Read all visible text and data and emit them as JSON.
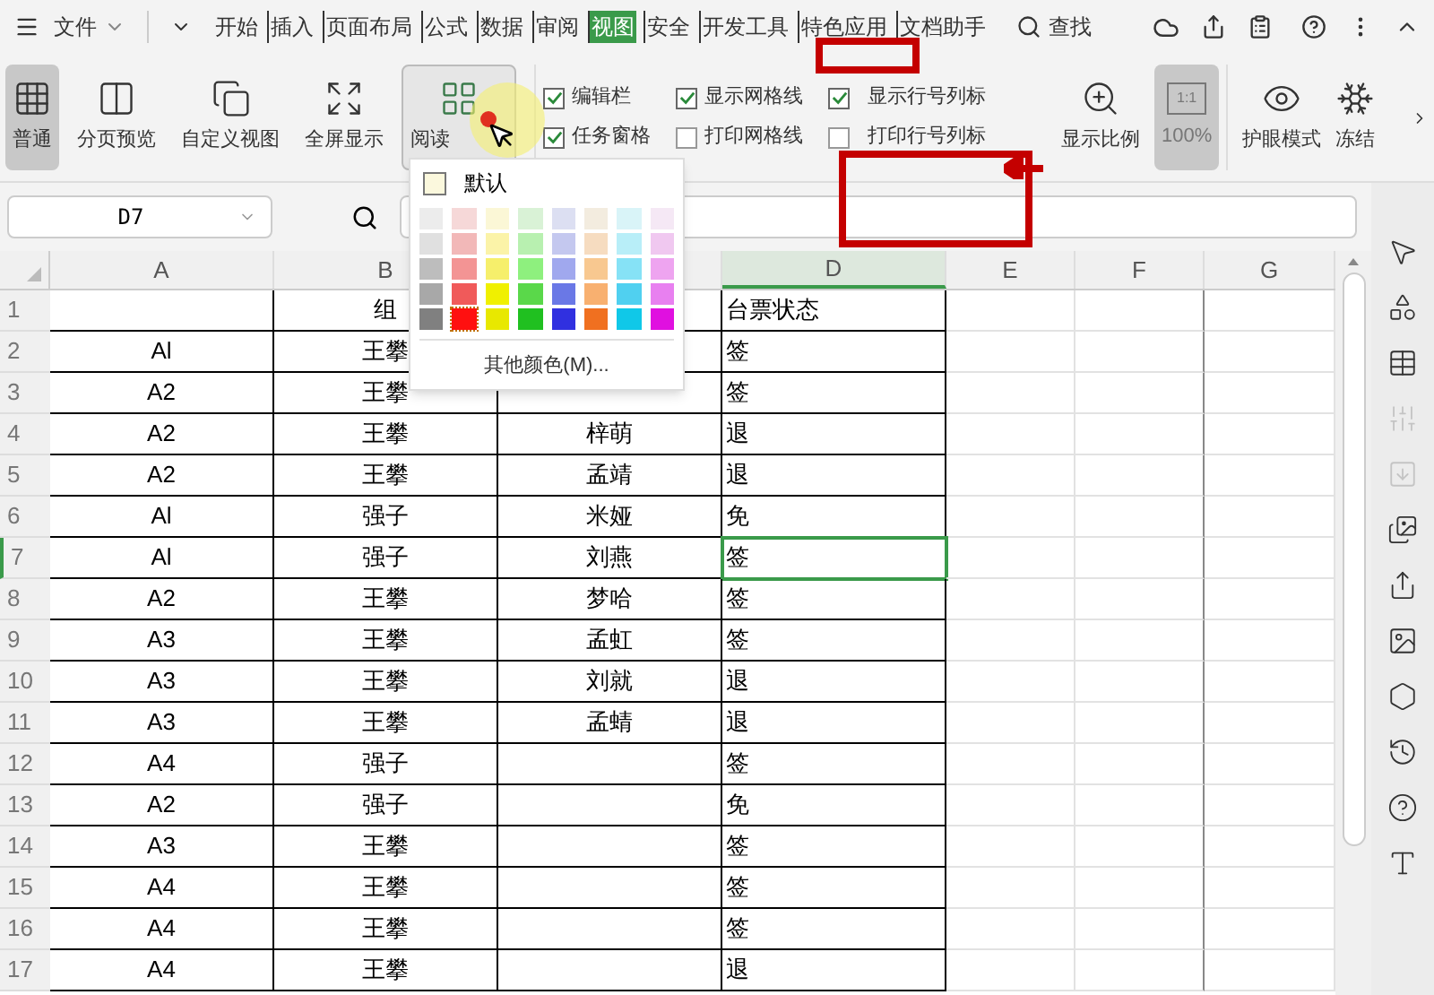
{
  "menu": {
    "file": "文件",
    "tabs": [
      {
        "label": "开始",
        "selected": false
      },
      {
        "label": "插入",
        "selected": false
      },
      {
        "label": "页面布局",
        "selected": false
      },
      {
        "label": "公式",
        "selected": false
      },
      {
        "label": "数据",
        "selected": false
      },
      {
        "label": "审阅",
        "selected": false
      },
      {
        "label": "视图",
        "selected": true
      },
      {
        "label": "安全",
        "selected": false
      },
      {
        "label": "开发工具",
        "selected": false
      },
      {
        "label": "特色应用",
        "selected": false
      },
      {
        "label": "文档助手",
        "selected": false
      }
    ],
    "search": "查找"
  },
  "ribbon": {
    "views": [
      {
        "label": "普通",
        "selected": true,
        "expanded": false
      },
      {
        "label": "分页预览",
        "selected": false,
        "expanded": false
      },
      {
        "label": "自定义视图",
        "selected": false,
        "expanded": false
      },
      {
        "label": "全屏显示",
        "selected": false,
        "expanded": false
      },
      {
        "label": "阅读",
        "selected": false,
        "expanded": true
      }
    ],
    "checkboxes": [
      {
        "label": "编辑栏",
        "checked": true
      },
      {
        "label": "显示网格线",
        "checked": true
      },
      {
        "label": "显示行号列标",
        "checked": true
      },
      {
        "label": "任务窗格",
        "checked": true
      },
      {
        "label": "打印网格线",
        "checked": false
      },
      {
        "label": "打印行号列标",
        "checked": false
      }
    ],
    "zoom_label": "显示比例",
    "ratio_icon": "1:1",
    "zoom_value": "100%",
    "eye": "护眼模式",
    "freeze": "冻结"
  },
  "color_menu": {
    "default": "默认",
    "more": "其他颜色(M)...",
    "swatches": [
      {
        "color": "#ececec",
        "selected": false
      },
      {
        "color": "#f6d8d8",
        "selected": false
      },
      {
        "color": "#fbf7d6",
        "selected": false
      },
      {
        "color": "#d9f2d6",
        "selected": false
      },
      {
        "color": "#dcdff2",
        "selected": false
      },
      {
        "color": "#f3ecdf",
        "selected": false
      },
      {
        "color": "#d9f4f8",
        "selected": false
      },
      {
        "color": "#f5e8f5",
        "selected": false
      },
      {
        "color": "#e0e0e0",
        "selected": false
      },
      {
        "color": "#f2b8b8",
        "selected": false
      },
      {
        "color": "#fbf3a8",
        "selected": false
      },
      {
        "color": "#b8f0b0",
        "selected": false
      },
      {
        "color": "#c4c8ef",
        "selected": false
      },
      {
        "color": "#f6dcc0",
        "selected": false
      },
      {
        "color": "#b8eef8",
        "selected": false
      },
      {
        "color": "#f0c8f0",
        "selected": false
      },
      {
        "color": "#bdbdbd",
        "selected": false
      },
      {
        "color": "#f39494",
        "selected": false
      },
      {
        "color": "#f6ef6b",
        "selected": false
      },
      {
        "color": "#8ef07e",
        "selected": false
      },
      {
        "color": "#a0a8ee",
        "selected": false
      },
      {
        "color": "#f8c890",
        "selected": false
      },
      {
        "color": "#86e2f6",
        "selected": false
      },
      {
        "color": "#eea4f0",
        "selected": false
      },
      {
        "color": "#a8a8a8",
        "selected": false
      },
      {
        "color": "#f05a5a",
        "selected": false
      },
      {
        "color": "#f0f000",
        "selected": false
      },
      {
        "color": "#5ad84a",
        "selected": false
      },
      {
        "color": "#6a78e6",
        "selected": false
      },
      {
        "color": "#f8b070",
        "selected": false
      },
      {
        "color": "#50d0f0",
        "selected": false
      },
      {
        "color": "#e880f0",
        "selected": false
      },
      {
        "color": "#808080",
        "selected": false
      },
      {
        "color": "#ff1010",
        "selected": true
      },
      {
        "color": "#e8e800",
        "selected": false
      },
      {
        "color": "#20c020",
        "selected": false
      },
      {
        "color": "#3030e0",
        "selected": false
      },
      {
        "color": "#f07020",
        "selected": false
      },
      {
        "color": "#10c8e8",
        "selected": false
      },
      {
        "color": "#e010e0",
        "selected": false
      }
    ]
  },
  "name_box": "D7",
  "side_tools": [
    {
      "disabled": false
    },
    {
      "disabled": false
    },
    {
      "disabled": false
    },
    {
      "disabled": true
    },
    {
      "disabled": true
    },
    {
      "disabled": false
    },
    {
      "disabled": false
    },
    {
      "disabled": false
    },
    {
      "disabled": false
    },
    {
      "disabled": false
    },
    {
      "disabled": false
    },
    {
      "disabled": false
    }
  ],
  "sheet": {
    "columns": [
      {
        "label": "A",
        "selected": false
      },
      {
        "label": "B",
        "selected": false
      },
      {
        "selected": false
      },
      {
        "label": "D",
        "selected": true
      },
      {
        "label": "E",
        "selected": false
      },
      {
        "label": "F",
        "selected": false
      },
      {
        "label": "G",
        "selected": false
      }
    ],
    "rows": [
      {
        "number": "1",
        "selected": false,
        "cells": [
          "",
          "组",
          "",
          "台票状态"
        ]
      },
      {
        "number": "2",
        "selected": false,
        "cells": [
          "Al",
          "王攀",
          "",
          "签"
        ]
      },
      {
        "number": "3",
        "selected": false,
        "cells": [
          "A2",
          "王攀",
          "",
          "签"
        ]
      },
      {
        "number": "4",
        "selected": false,
        "cells": [
          "A2",
          "王攀",
          "梓萌",
          "退"
        ]
      },
      {
        "number": "5",
        "selected": false,
        "cells": [
          "A2",
          "王攀",
          "孟靖",
          "退"
        ]
      },
      {
        "number": "6",
        "selected": false,
        "cells": [
          "Al",
          "强子",
          "米娅",
          "免"
        ]
      },
      {
        "number": "7",
        "selected": true,
        "cells": [
          "Al",
          "强子",
          "刘燕",
          "签"
        ]
      },
      {
        "number": "8",
        "selected": false,
        "cells": [
          "A2",
          "王攀",
          "梦哈",
          "签"
        ]
      },
      {
        "number": "9",
        "selected": false,
        "cells": [
          "A3",
          "王攀",
          "孟虹",
          "签"
        ]
      },
      {
        "number": "10",
        "selected": false,
        "cells": [
          "A3",
          "王攀",
          "刘就",
          "退"
        ]
      },
      {
        "number": "11",
        "selected": false,
        "cells": [
          "A3",
          "王攀",
          "孟蜻",
          "退"
        ]
      },
      {
        "number": "12",
        "selected": false,
        "cells": [
          "A4",
          "强子",
          "",
          "签"
        ]
      },
      {
        "number": "13",
        "selected": false,
        "cells": [
          "A2",
          "强子",
          "",
          "免"
        ]
      },
      {
        "number": "14",
        "selected": false,
        "cells": [
          "A3",
          "王攀",
          "",
          "签"
        ]
      },
      {
        "number": "15",
        "selected": false,
        "cells": [
          "A4",
          "王攀",
          "",
          "签"
        ]
      },
      {
        "number": "16",
        "selected": false,
        "cells": [
          "A4",
          "王攀",
          "",
          "签"
        ]
      },
      {
        "number": "17",
        "selected": false,
        "cells": [
          "A4",
          "王攀",
          "",
          "退"
        ]
      }
    ]
  }
}
